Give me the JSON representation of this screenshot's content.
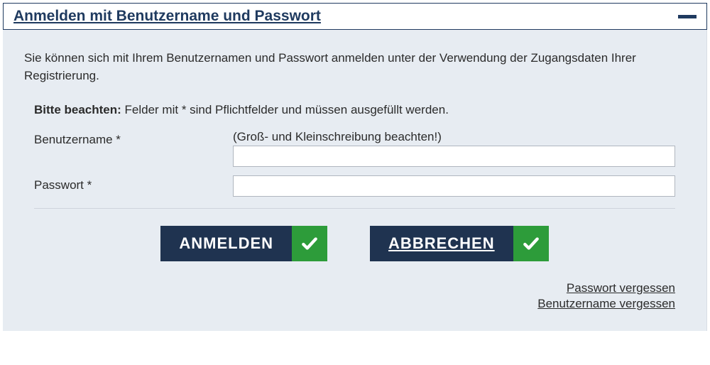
{
  "header": {
    "title": "Anmelden mit Benutzername und Passwort"
  },
  "body": {
    "description": "Sie können sich mit Ihrem Benutzernamen und Passwort anmelden unter der Verwendung der Zugangsdaten Ihrer Registrierung.",
    "notice_bold": "Bitte beachten:",
    "notice_text": " Felder mit * sind Pflichtfelder und müssen ausgefüllt werden."
  },
  "form": {
    "username_label": "Benutzername *",
    "username_hint": "(Groß- und Kleinschreibung beachten!)",
    "username_value": "",
    "password_label": "Passwort *",
    "password_value": ""
  },
  "buttons": {
    "login_label": "ANMELDEN",
    "cancel_label": "ABBRECHEN"
  },
  "links": {
    "forgot_password": "Passwort vergessen",
    "forgot_username": "Benutzername vergessen"
  }
}
